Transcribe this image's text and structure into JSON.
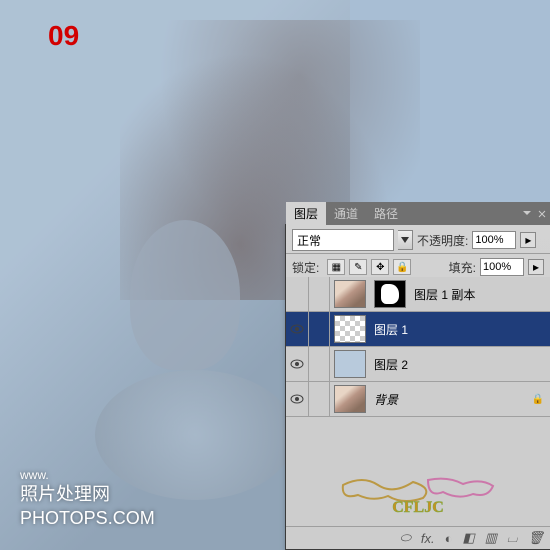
{
  "step_number": "09",
  "watermark": {
    "prefix": "www.",
    "main": "照片处理网",
    "url": "PHOTOPS.COM"
  },
  "panel": {
    "tabs": {
      "layers": "图层",
      "channels": "通道",
      "paths": "路径"
    },
    "blend_mode": "正常",
    "opacity_label": "不透明度:",
    "opacity_value": "100%",
    "lock_label": "锁定:",
    "fill_label": "填充:",
    "fill_value": "100%",
    "layer_rows": [
      {
        "name": "图层 1 副本",
        "visible": false,
        "selected": false,
        "thumb": "photo",
        "mask": true,
        "italic": false,
        "locked": false
      },
      {
        "name": "图层 1",
        "visible": true,
        "selected": true,
        "thumb": "chk",
        "mask": false,
        "italic": false,
        "locked": false
      },
      {
        "name": "图层 2",
        "visible": true,
        "selected": false,
        "thumb": "blue",
        "mask": false,
        "italic": false,
        "locked": false
      },
      {
        "name": "背景",
        "visible": true,
        "selected": false,
        "thumb": "photo",
        "mask": false,
        "italic": true,
        "locked": true
      }
    ],
    "tool_icons": [
      "⬭",
      "fx.",
      "◐",
      "◧",
      "▥",
      "⌴",
      "🗑"
    ]
  },
  "deco_text": "CFLJC"
}
